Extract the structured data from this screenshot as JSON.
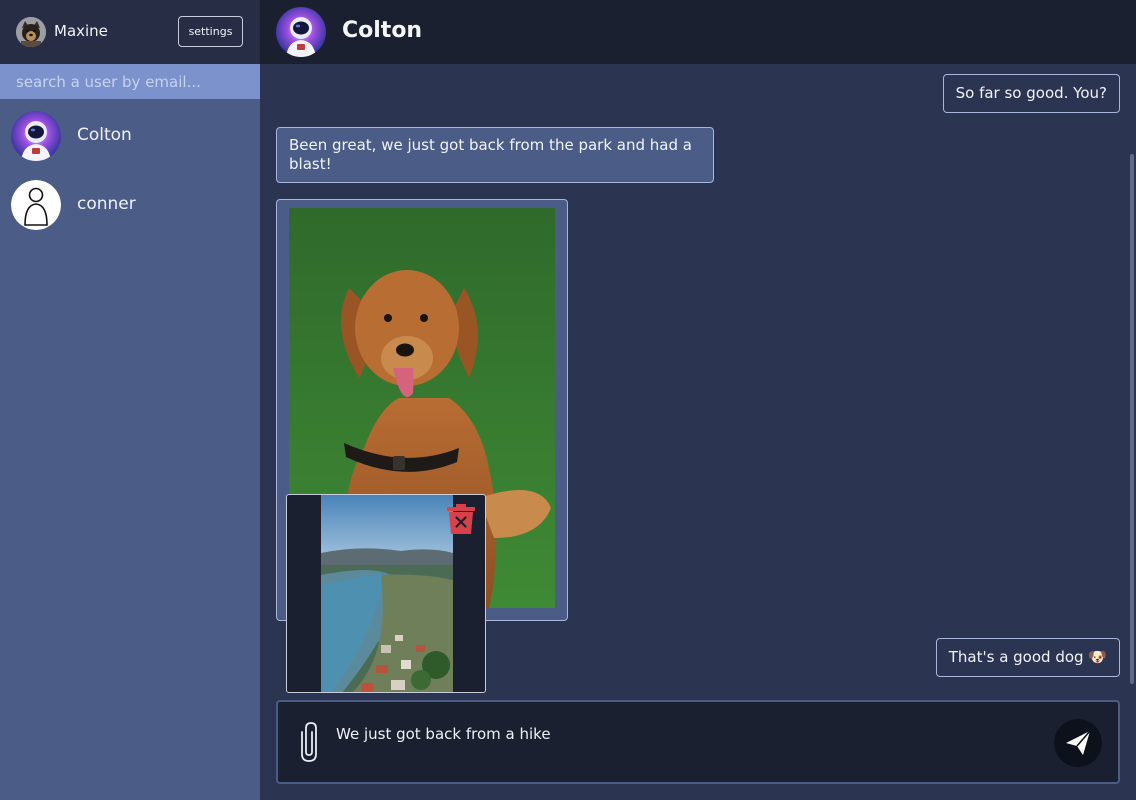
{
  "sidebar": {
    "current_user": {
      "name": "Maxine"
    },
    "settings_label": "settings",
    "search_placeholder": "search a user by email...",
    "contacts": [
      {
        "name": "Colton",
        "avatar": "astronaut"
      },
      {
        "name": "conner",
        "avatar": "default-user"
      }
    ]
  },
  "chat": {
    "title": "Colton",
    "messages": [
      {
        "direction": "outgoing",
        "text": "So far so good. You?"
      },
      {
        "direction": "incoming",
        "text": "Been great, we just got back from the park and had a blast!"
      },
      {
        "direction": "incoming",
        "type": "image",
        "image": "golden-retriever-on-grass"
      },
      {
        "direction": "outgoing",
        "text": "That's a good dog 🐶"
      }
    ]
  },
  "composer": {
    "value": "We just got back from a hike",
    "attachment_preview": {
      "image": "river-valley-town",
      "delete_icon": "trash-icon"
    },
    "attach_icon": "paperclip-icon",
    "send_icon": "paper-plane-icon"
  },
  "colors": {
    "sidebar_bg": "#4b5c86",
    "header_bg": "#1b2030",
    "chat_bg": "#2b3451",
    "search_bg": "#7b92cc",
    "delete_red": "#d9414a"
  }
}
